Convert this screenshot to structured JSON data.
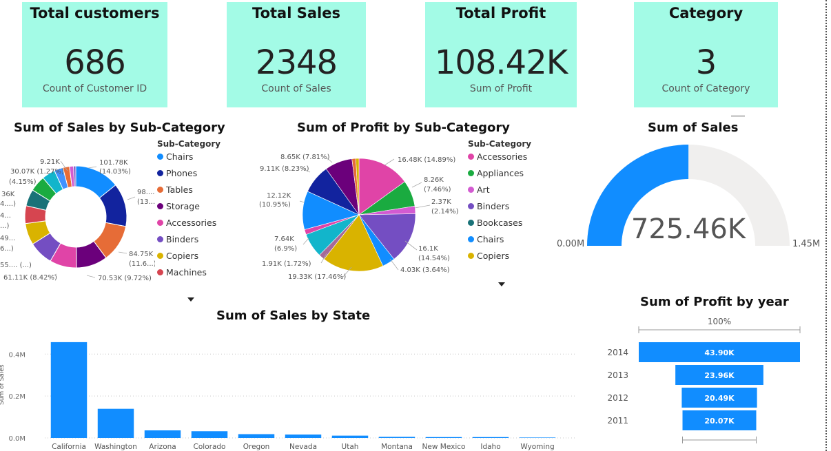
{
  "kpis": [
    {
      "title": "Total customers",
      "value": "686",
      "sub": "Count of Customer ID"
    },
    {
      "title": "Total Sales",
      "value": "2348",
      "sub": "Count of Sales"
    },
    {
      "title": "Total Profit",
      "value": "108.42K",
      "sub": "Sum of Profit"
    },
    {
      "title": "Category",
      "value": "3",
      "sub": "Count of Category"
    }
  ],
  "colors": {
    "kpi_bg": "#a3fbe6",
    "bar": "#118dff",
    "gauge_fill": "#118dff",
    "gauge_track": "#f0efee"
  },
  "donut": {
    "title": "Sum of Sales by Sub-Category",
    "legend_title": "Sub-Category",
    "legend": [
      {
        "label": "Chairs",
        "color": "#118dff"
      },
      {
        "label": "Phones",
        "color": "#12239e"
      },
      {
        "label": "Tables",
        "color": "#e66c37"
      },
      {
        "label": "Storage",
        "color": "#6b007b"
      },
      {
        "label": "Accessories",
        "color": "#e044a7"
      },
      {
        "label": "Binders",
        "color": "#744ec2"
      },
      {
        "label": "Copiers",
        "color": "#d9b300"
      },
      {
        "label": "Machines",
        "color": "#d64550"
      }
    ],
    "labels": [
      "9.21K",
      "30.07K (1.27%)",
      "(4.15%)",
      "101.78K",
      "(14.03%)",
      "98....",
      "(13...",
      "84.75K",
      "(11.6...)",
      "70.53K (9.72%)",
      "61.11K (8.42%)",
      "55.... (...)",
      "49...",
      "6...)",
      "4...",
      "...)",
      "36K",
      "4....)"
    ]
  },
  "pie": {
    "title": "Sum of Profit by Sub-Category",
    "legend_title": "Sub-Category",
    "legend": [
      {
        "label": "Accessories",
        "color": "#e044a7"
      },
      {
        "label": "Appliances",
        "color": "#1aab40"
      },
      {
        "label": "Art",
        "color": "#d35bd1"
      },
      {
        "label": "Binders",
        "color": "#744ec2"
      },
      {
        "label": "Bookcases",
        "color": "#197278"
      },
      {
        "label": "Chairs",
        "color": "#118dff"
      },
      {
        "label": "Copiers",
        "color": "#d9b300"
      }
    ],
    "labels": [
      "8.65K (7.81%)",
      "9.11K (8.23%)",
      "12.12K",
      "(10.95%)",
      "7.64K",
      "(6.9%)",
      "1.91K (1.72%)",
      "19.33K (17.46%)",
      "16.48K (14.89%)",
      "8.26K",
      "(7.46%)",
      "2.37K",
      "(2.14%)",
      "16.1K",
      "(14.54%)",
      "4.03K (3.64%)"
    ]
  },
  "gauge": {
    "title": "Sum of Sales",
    "value": "725.46K",
    "min": "0.00M",
    "max": "1.45M",
    "fraction": 0.5003
  },
  "funnel": {
    "title": "Sum of Profit by year",
    "top_pct": "100%",
    "rows": [
      {
        "year": "2014",
        "label": "43.90K",
        "value": 43.9
      },
      {
        "year": "2013",
        "label": "23.96K",
        "value": 23.96
      },
      {
        "year": "2012",
        "label": "20.49K",
        "value": 20.49
      },
      {
        "year": "2011",
        "label": "20.07K",
        "value": 20.07
      }
    ]
  },
  "chart_data": {
    "type": "bar",
    "title": "Sum of Sales by State",
    "xlabel": "",
    "ylabel": "Sum of Sales",
    "yticks": [
      "0.0M",
      "0.2M",
      "0.4M"
    ],
    "ylim": [
      0,
      0.46
    ],
    "grid": true,
    "categories": [
      "California",
      "Washington",
      "Arizona",
      "Colorado",
      "Oregon",
      "Nevada",
      "Utah",
      "Montana",
      "New Mexico",
      "Idaho",
      "Wyoming"
    ],
    "values": [
      0.457,
      0.139,
      0.036,
      0.032,
      0.018,
      0.016,
      0.011,
      0.005,
      0.004,
      0.004,
      0.002
    ]
  }
}
